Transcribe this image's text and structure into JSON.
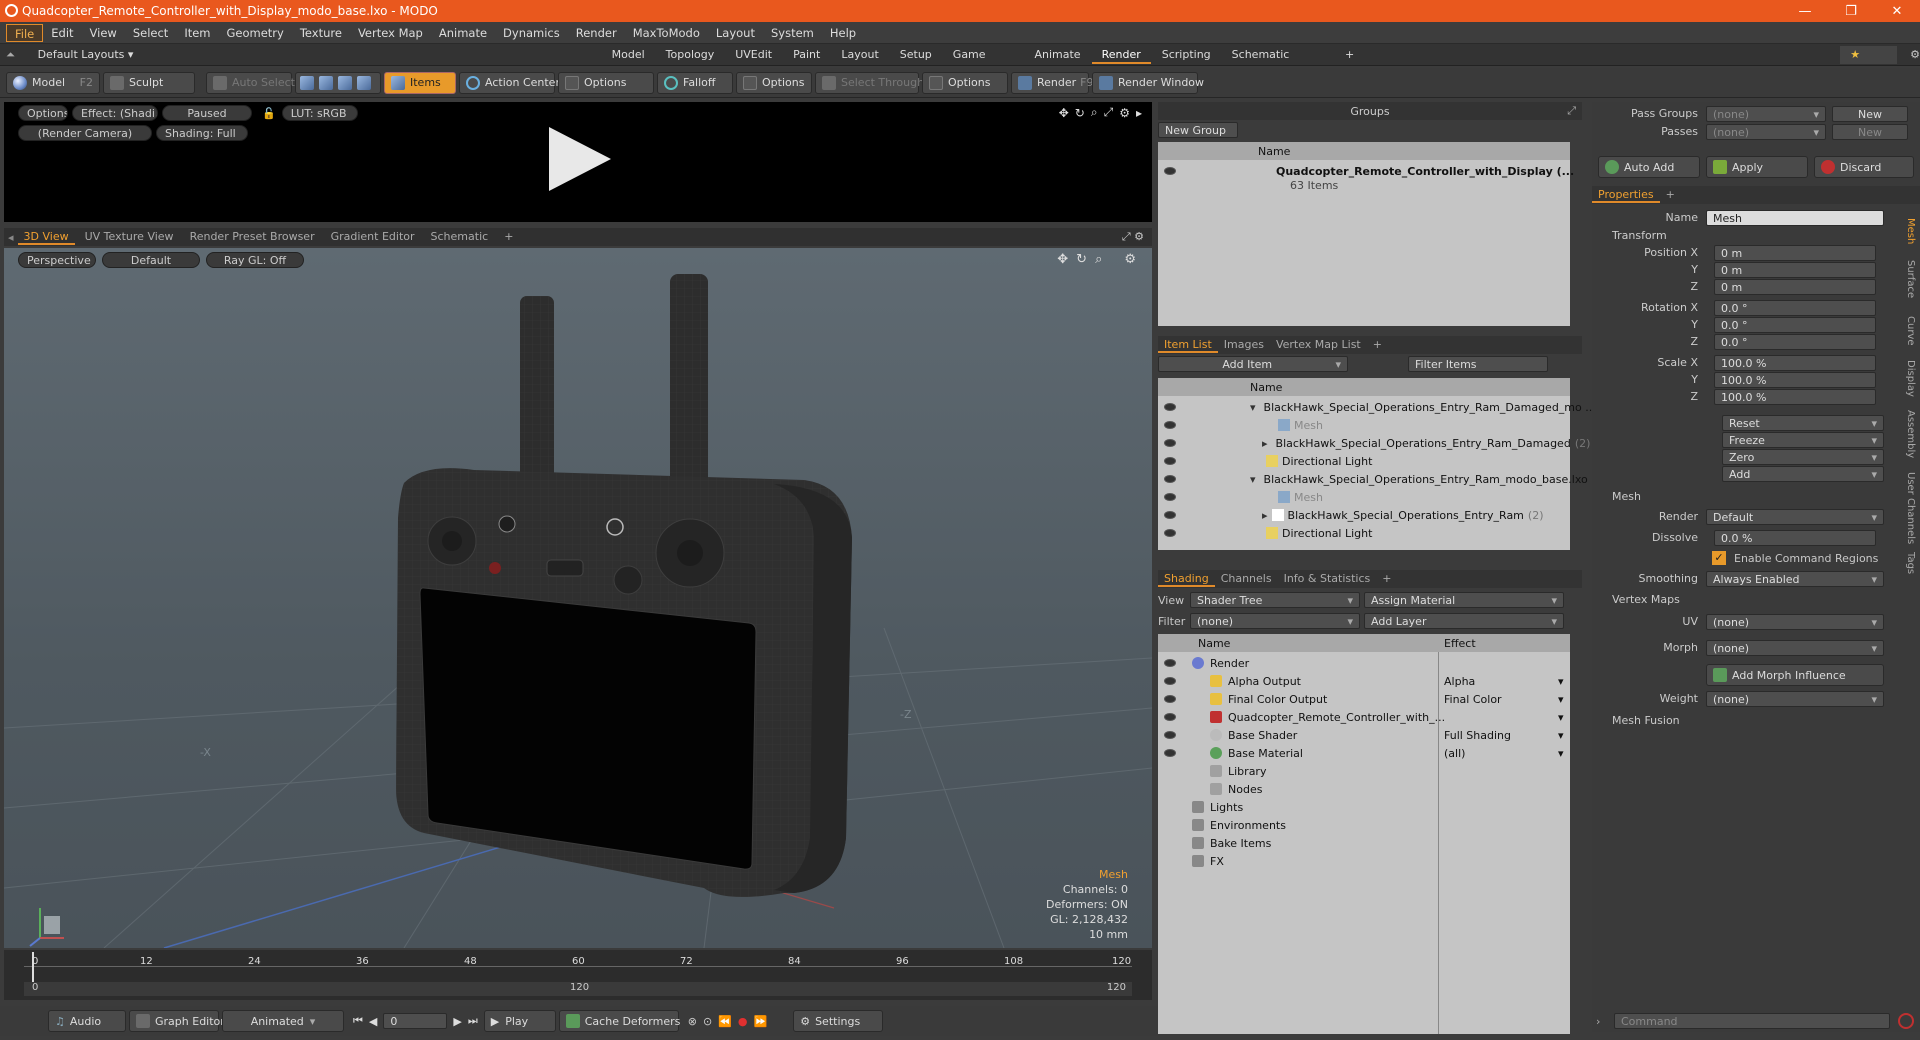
{
  "window": {
    "title": "Quadcopter_Remote_Controller_with_Display_modo_base.lxo - MODO",
    "minimize": "—",
    "restore": "❐",
    "close": "✕"
  },
  "menu": [
    "File",
    "Edit",
    "View",
    "Select",
    "Item",
    "Geometry",
    "Texture",
    "Vertex Map",
    "Animate",
    "Dynamics",
    "Render",
    "MaxToModo",
    "Layout",
    "System",
    "Help"
  ],
  "layouts": {
    "default": "Default Layouts ▾",
    "tabs": [
      "Model",
      "Topology",
      "UVEdit",
      "Paint",
      "Layout",
      "Setup",
      "Game Tools",
      "Animate",
      "Render",
      "Scripting",
      "Schematic Fusion"
    ],
    "active": "Render",
    "only": "★  Only"
  },
  "toolbar": {
    "model": "Model",
    "model_key": "F2",
    "sculpt": "Sculpt",
    "auto_select": "Auto Select",
    "items": "Items",
    "action_center": "Action Center",
    "options1": "Options",
    "falloff": "Falloff",
    "options2": "Options",
    "select_through": "Select Through",
    "options3": "Options",
    "render": "Render",
    "render_key": "F9",
    "render_window": "Render Window"
  },
  "preview": {
    "options": "Options",
    "effect": "Effect: (Shadi...",
    "paused": "Paused",
    "lut": "LUT: sRGB",
    "camera": "(Render Camera)",
    "shading": "Shading: Full"
  },
  "viewport_tabs": [
    "3D View",
    "UV Texture View",
    "Render Preset Browser",
    "Gradient Editor",
    "Schematic",
    "+"
  ],
  "viewport": {
    "perspective": "Perspective",
    "default": "Default",
    "raygl": "Ray GL: Off",
    "axis_x": "-X",
    "axis_z": "-Z",
    "hud": {
      "mesh": "Mesh",
      "channels": "Channels: 0",
      "deformers": "Deformers: ON",
      "gl": "GL: 2,128,432",
      "scale": "10 mm"
    }
  },
  "timeline": {
    "ticks": [
      "0",
      "12",
      "24",
      "36",
      "48",
      "60",
      "72",
      "84",
      "96",
      "108",
      "120"
    ],
    "start": "0",
    "mid": "120",
    "end": "120"
  },
  "bottom": {
    "audio": "Audio",
    "graph_editor": "Graph Editor",
    "animated": "Animated",
    "frame": "0",
    "play": "Play",
    "cache_deformers": "Cache Deformers",
    "settings": "Settings"
  },
  "groups": {
    "title": "Groups",
    "new_group": "New Group",
    "name_col": "Name",
    "item_name": "Quadcopter_Remote_Controller_with_Display (...",
    "item_count": "63 Items"
  },
  "itemlist": {
    "tabs": [
      "Item List",
      "Images",
      "Vertex Map List",
      "+"
    ],
    "add_item": "Add Item",
    "filter": "Filter Items",
    "name_col": "Name",
    "rows": [
      {
        "label": "BlackHawk_Special_Operations_Entry_Ram_Damaged_mo ...",
        "indent": 0,
        "kind": "scene"
      },
      {
        "label": "Mesh",
        "indent": 2,
        "kind": "mesh"
      },
      {
        "label": "BlackHawk_Special_Operations_Entry_Ram_Damaged",
        "count": "(2)",
        "indent": 1,
        "kind": "group"
      },
      {
        "label": "Directional Light",
        "indent": 1,
        "kind": "light"
      },
      {
        "label": "BlackHawk_Special_Operations_Entry_Ram_modo_base.lxo",
        "indent": 0,
        "kind": "scene"
      },
      {
        "label": "Mesh",
        "indent": 2,
        "kind": "mesh"
      },
      {
        "label": "BlackHawk_Special_Operations_Entry_Ram",
        "count": "(2)",
        "indent": 1,
        "kind": "group"
      },
      {
        "label": "Directional Light",
        "indent": 1,
        "kind": "light"
      }
    ]
  },
  "shading": {
    "tabs": [
      "Shading",
      "Channels",
      "Info & Statistics",
      "+"
    ],
    "view_label": "View",
    "view_value": "Shader Tree",
    "assign": "Assign Material",
    "filter_label": "Filter",
    "filter_value": "(none)",
    "add_layer": "Add Layer",
    "name_col": "Name",
    "effect_col": "Effect",
    "rows": [
      {
        "label": "Render",
        "effect": "",
        "indent": 0
      },
      {
        "label": "Alpha Output",
        "effect": "Alpha",
        "indent": 1
      },
      {
        "label": "Final Color Output",
        "effect": "Final Color",
        "indent": 1
      },
      {
        "label": "Quadcopter_Remote_Controller_with_...",
        "effect": "",
        "indent": 1
      },
      {
        "label": "Base Shader",
        "effect": "Full Shading",
        "indent": 1
      },
      {
        "label": "Base Material",
        "effect": "(all)",
        "indent": 1
      },
      {
        "label": "Library",
        "effect": "",
        "indent": 1
      },
      {
        "label": "Nodes",
        "effect": "",
        "indent": 1
      },
      {
        "label": "Lights",
        "effect": "",
        "indent": 0
      },
      {
        "label": "Environments",
        "effect": "",
        "indent": 0
      },
      {
        "label": "Bake Items",
        "effect": "",
        "indent": 0
      },
      {
        "label": "FX",
        "effect": "",
        "indent": 0
      }
    ]
  },
  "props": {
    "pass_groups": "Pass Groups",
    "passes": "Passes",
    "none": "(none)",
    "new": "New",
    "auto_add": "Auto Add",
    "apply": "Apply",
    "discard": "Discard",
    "tab": "Properties",
    "name_label": "Name",
    "name_value": "Mesh",
    "transform": "Transform",
    "position_x": "Position X",
    "rotation_x": "Rotation X",
    "scale_x": "Scale X",
    "y": "Y",
    "z": "Z",
    "pos": [
      "0 m",
      "0 m",
      "0 m"
    ],
    "rot": [
      "0.0 °",
      "0.0 °",
      "0.0 °"
    ],
    "scl": [
      "100.0 %",
      "100.0 %",
      "100.0 %"
    ],
    "reset": "Reset",
    "freeze": "Freeze",
    "zero": "Zero",
    "add": "Add",
    "mesh": "Mesh",
    "render_label": "Render",
    "render_value": "Default",
    "dissolve_label": "Dissolve",
    "dissolve_value": "0.0 %",
    "enable_cmd": "Enable Command Regions",
    "smoothing_label": "Smoothing",
    "smoothing_value": "Always Enabled",
    "vertex_maps": "Vertex Maps",
    "uv_label": "UV",
    "morph_label": "Morph",
    "add_morph": "Add Morph Influence",
    "weight_label": "Weight",
    "mesh_fusion": "Mesh Fusion",
    "command": "Command",
    "sidetabs": [
      "Mesh",
      "Surface",
      "Curve",
      "Display",
      "Assembly",
      "User Channels",
      "Tags"
    ]
  },
  "colors": {
    "accent": "#e08a2a",
    "titlebar": "#e9581e"
  }
}
